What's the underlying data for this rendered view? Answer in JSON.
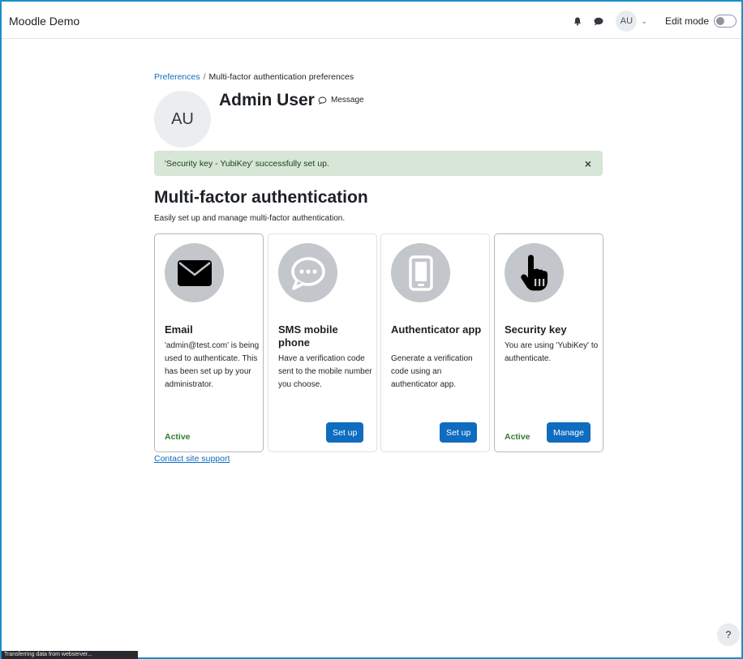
{
  "navbar": {
    "brand": "Moodle Demo",
    "avatar_initials": "AU",
    "edit_mode_label": "Edit mode"
  },
  "breadcrumb": {
    "parent": "Preferences",
    "separator": "/",
    "current": "Multi-factor authentication preferences"
  },
  "user": {
    "initials": "AU",
    "name": "Admin User",
    "message_label": "Message"
  },
  "alert": {
    "message": "'Security key - YubiKey' successfully set up.",
    "close": "×"
  },
  "page": {
    "title": "Multi-factor authentication",
    "description": "Easily set up and manage multi-factor authentication."
  },
  "factors": [
    {
      "title": "Email",
      "description": "'admin@test.com' is being used to authenticate. This has been set up by your administrator.",
      "status": "Active",
      "icon": "envelope-icon"
    },
    {
      "title": "SMS mobile phone",
      "description": "Have a verification code sent to the mobile number you choose.",
      "button": "Set up",
      "icon": "chat-icon"
    },
    {
      "title": "Authenticator app",
      "description": "Generate a verification code using an authenticator app.",
      "button": "Set up",
      "icon": "phone-icon"
    },
    {
      "title": "Security key",
      "description": "You are using 'YubiKey' to authenticate.",
      "status": "Active",
      "button": "Manage",
      "icon": "pointing-hand-icon"
    }
  ],
  "support_link": "Contact site support",
  "help_label": "?",
  "statusbar_text": "Transferring data from webserver...",
  "colors": {
    "primary": "#0f6cbf",
    "success_text": "#357a32",
    "alert_bg": "#d7e6d6",
    "icon_circle": "#c3c6ca"
  }
}
